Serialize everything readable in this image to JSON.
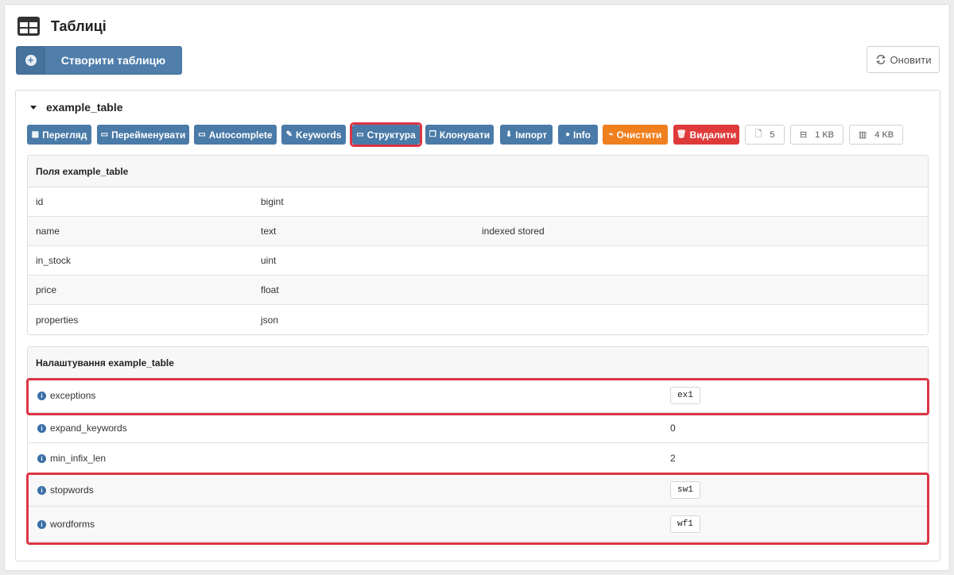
{
  "header": {
    "title": "Таблиці"
  },
  "toolbar": {
    "create_label": "Створити таблицю",
    "refresh_label": "Оновити"
  },
  "table": {
    "name": "example_table",
    "actions": [
      {
        "label": "Перегляд",
        "icon": "grid-icon"
      },
      {
        "label": "Перейменувати",
        "icon": "rename-icon"
      },
      {
        "label": "Autocomplete",
        "icon": "keyboard-icon"
      },
      {
        "label": "Keywords",
        "icon": "edit-icon"
      },
      {
        "label": "Структура",
        "icon": "structure-icon"
      },
      {
        "label": "Клонувати",
        "icon": "clone-icon"
      },
      {
        "label": "Імпорт",
        "icon": "download-icon"
      },
      {
        "label": "Info",
        "icon": "info-icon"
      },
      {
        "label": "Очистити",
        "icon": "broom-icon"
      },
      {
        "label": "Видалити",
        "icon": "trash-icon"
      }
    ],
    "stats": [
      {
        "value": "5",
        "icon": "document-icon"
      },
      {
        "value": "1 KB",
        "icon": "disk-icon"
      },
      {
        "value": "4 KB",
        "icon": "memory-icon"
      }
    ],
    "fields_title": "Поля example_table",
    "fields": [
      {
        "name": "id",
        "type": "bigint",
        "props": ""
      },
      {
        "name": "name",
        "type": "text",
        "props": "indexed stored"
      },
      {
        "name": "in_stock",
        "type": "uint",
        "props": ""
      },
      {
        "name": "price",
        "type": "float",
        "props": ""
      },
      {
        "name": "properties",
        "type": "json",
        "props": ""
      }
    ],
    "settings_title": "Налаштування example_table",
    "settings": [
      {
        "name": "exceptions",
        "value": "ex1",
        "code": true
      },
      {
        "name": "expand_keywords",
        "value": "0",
        "code": false
      },
      {
        "name": "min_infix_len",
        "value": "2",
        "code": false
      },
      {
        "name": "stopwords",
        "value": "sw1",
        "code": true
      },
      {
        "name": "wordforms",
        "value": "wf1",
        "code": true
      }
    ]
  },
  "colors": {
    "primary": "#4a7aa7",
    "warning": "#f07f1e",
    "danger": "#de3a3a",
    "highlight": "#dc3545"
  }
}
